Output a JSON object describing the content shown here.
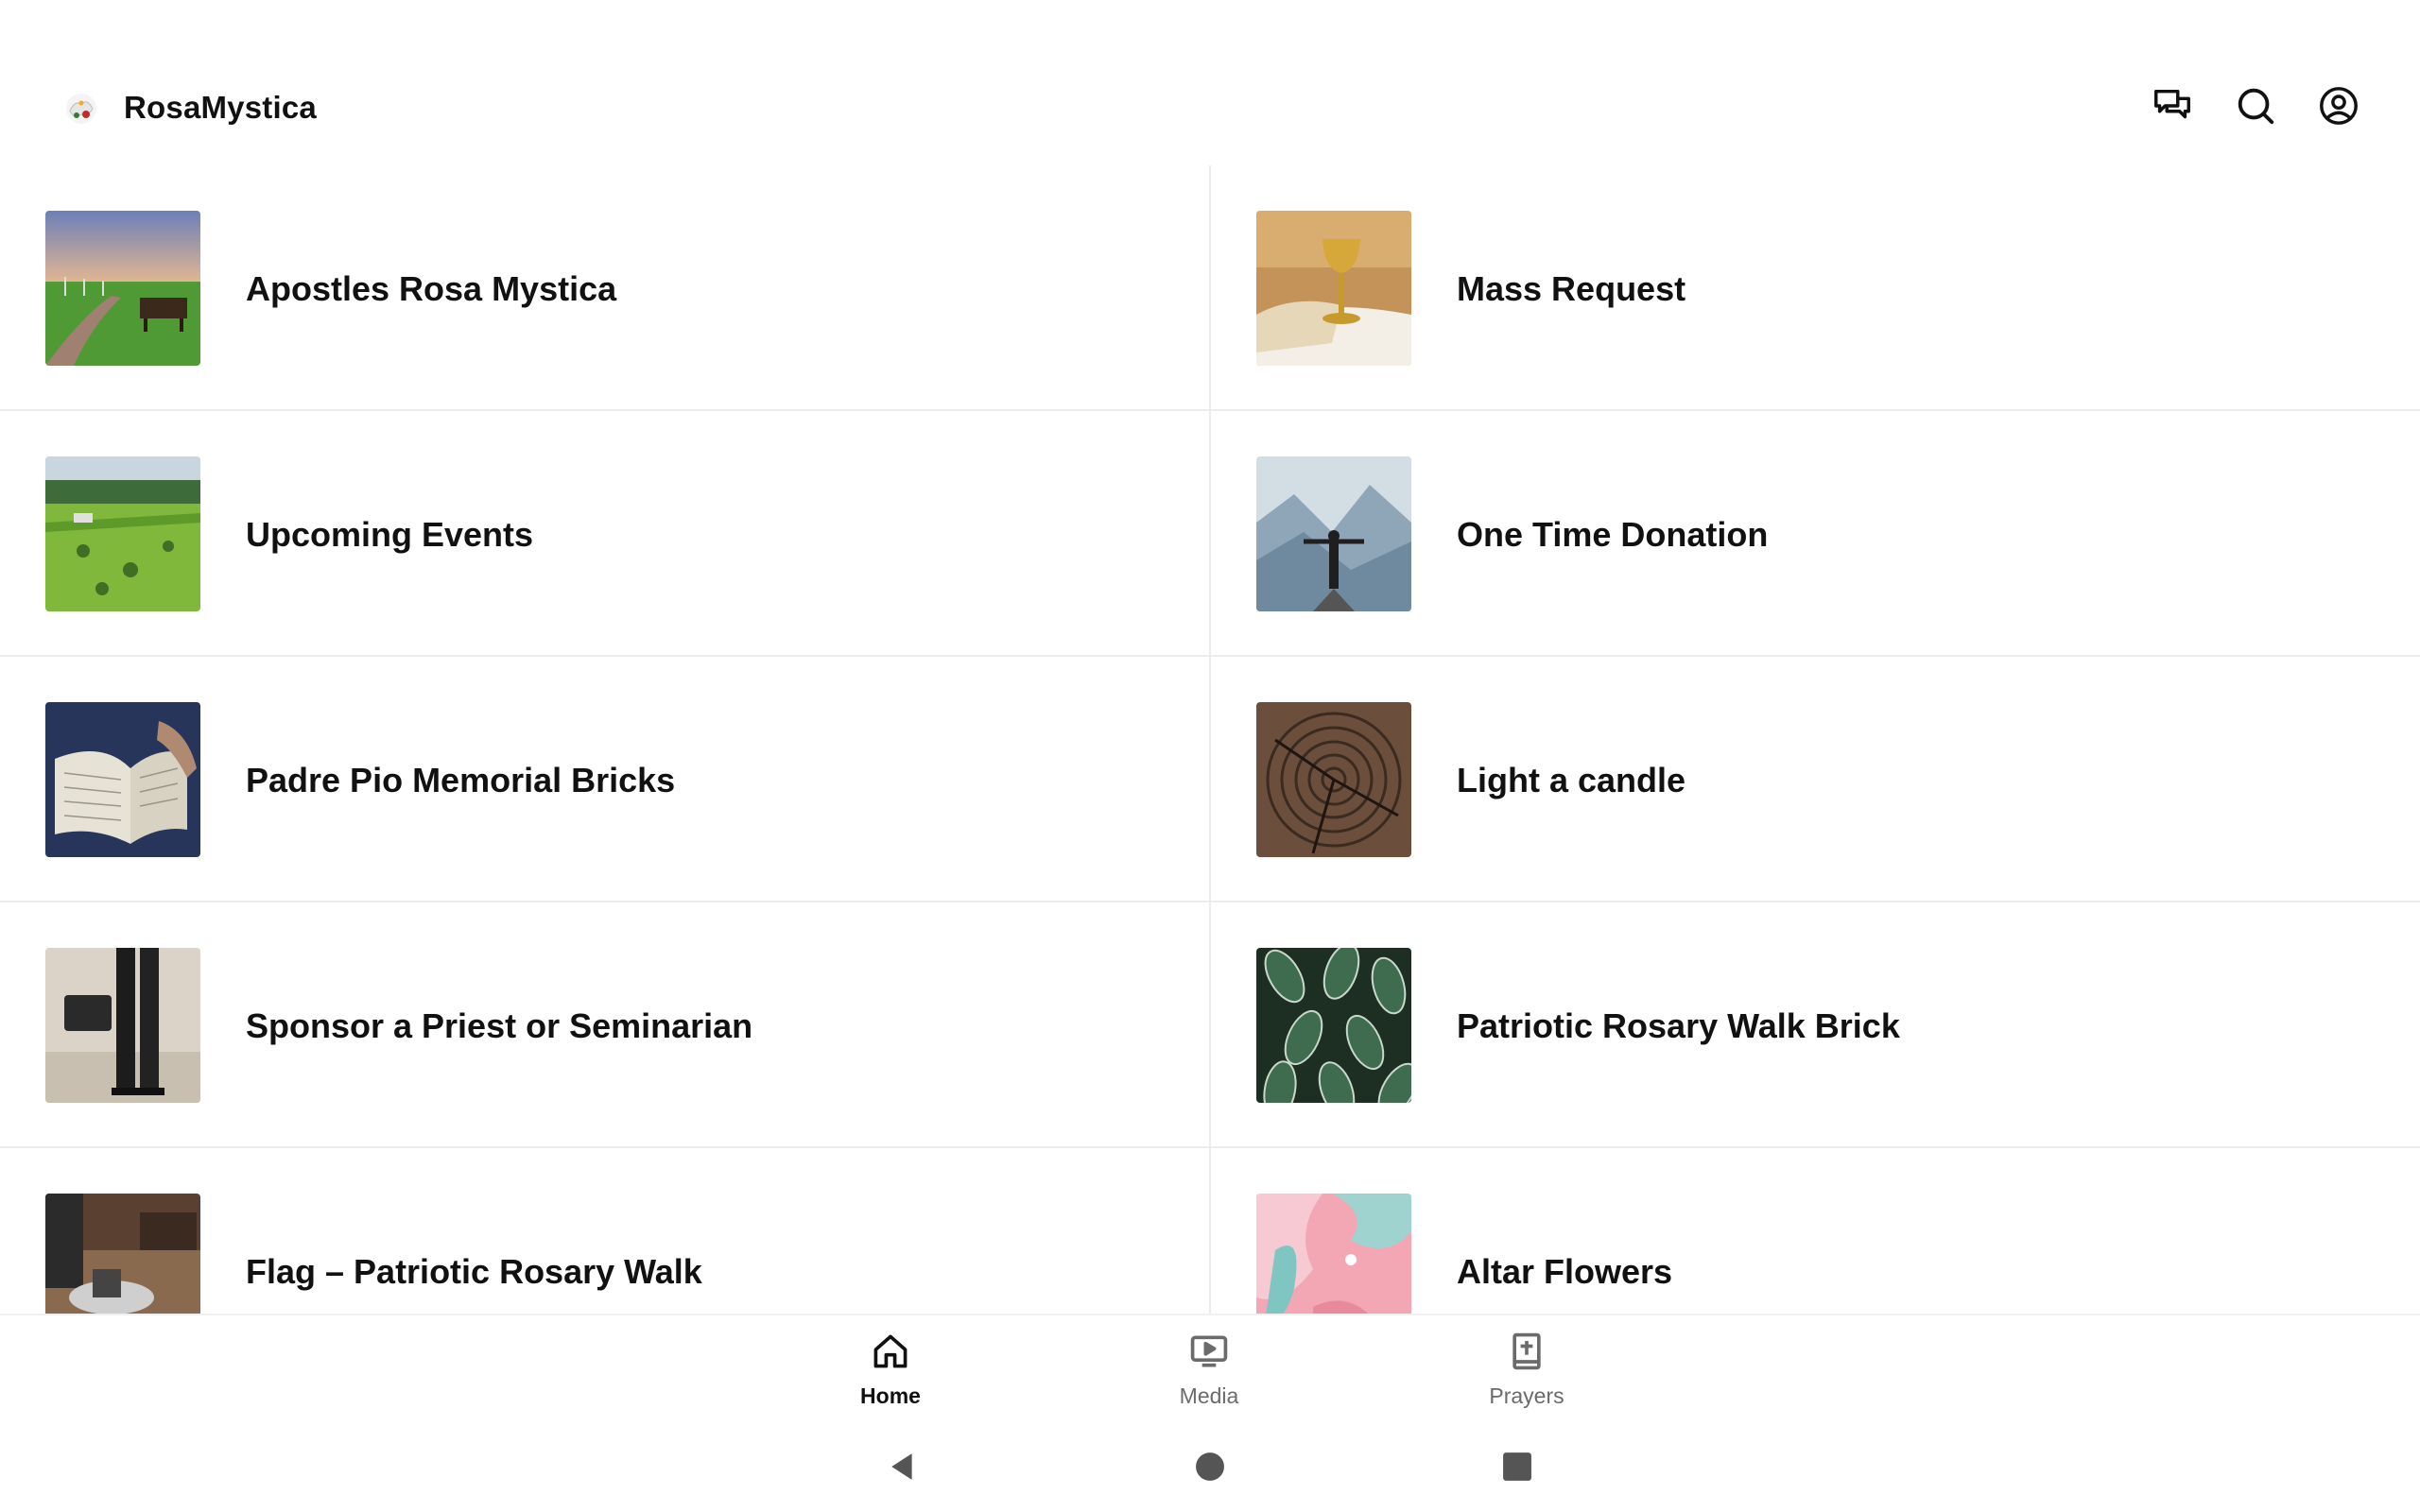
{
  "app": {
    "title": "RosaMystica",
    "header_icons": [
      "chat-icon",
      "search-icon",
      "account-icon"
    ]
  },
  "tiles": [
    {
      "label": "Apostles Rosa Mystica",
      "image": "memorial-garden-bench"
    },
    {
      "label": "Mass Request",
      "image": "golden-chalice-bible"
    },
    {
      "label": "Upcoming Events",
      "image": "green-countryside-aerial"
    },
    {
      "label": "One Time Donation",
      "image": "man-arms-open-mountains"
    },
    {
      "label": "Padre Pio Memorial Bricks",
      "image": "open-bible-hands"
    },
    {
      "label": "Light a candle",
      "image": "tree-rings-wood"
    },
    {
      "label": "Sponsor a Priest or Seminarian",
      "image": "person-walking-sand"
    },
    {
      "label": "Patriotic Rosary Walk Brick",
      "image": "green-patterned-leaves"
    },
    {
      "label": "Flag – Patriotic Rosary Walk",
      "image": "room-interior-table"
    },
    {
      "label": "Altar Flowers",
      "image": "pink-teal-fluid-art"
    }
  ],
  "bottom_nav": [
    {
      "label": "Home",
      "icon": "home-icon",
      "active": true
    },
    {
      "label": "Media",
      "icon": "media-icon",
      "active": false
    },
    {
      "label": "Prayers",
      "icon": "prayer-book-icon",
      "active": false
    }
  ],
  "system_nav": [
    "back-icon",
    "home-circle-icon",
    "recents-square-icon"
  ],
  "colors": {
    "text": "#111111",
    "inactive": "#6b6b6b",
    "divider": "#ececec",
    "background": "#ffffff"
  }
}
